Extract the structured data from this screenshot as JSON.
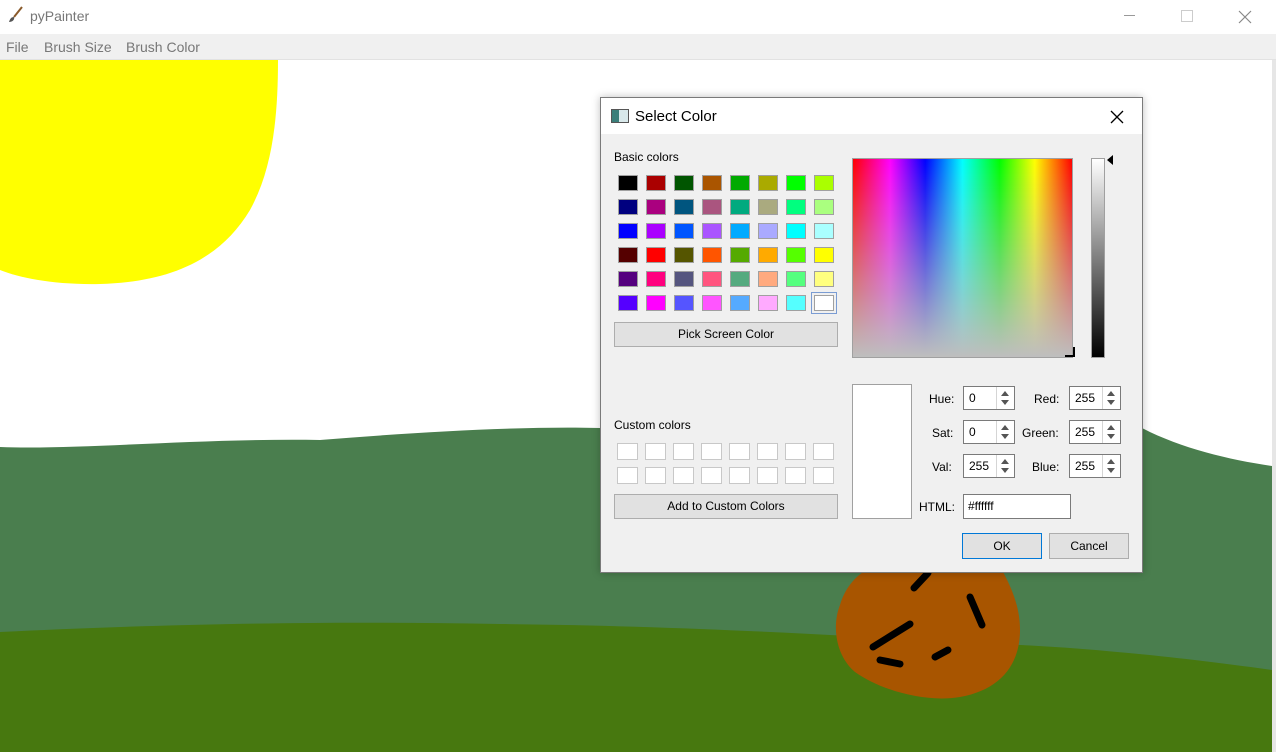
{
  "window": {
    "title": "pyPainter",
    "controls": {
      "minimize": "minimize-icon",
      "maximize": "maximize-icon",
      "close": "close-icon"
    }
  },
  "menu": [
    "File",
    "Brush Size",
    "Brush Color"
  ],
  "canvas": {
    "background": "#ffffff",
    "sun_color": "#ffff00",
    "hill_back_color": "#4a7e4e",
    "hill_front_color": "#47780f",
    "bush_color": "#a85500",
    "stroke_color": "#000000"
  },
  "dialog": {
    "title": "Select Color",
    "basic_colors_label": "Basic colors",
    "basic_colors": [
      [
        "#000000",
        "#aa0000",
        "#005500",
        "#aa5500",
        "#00aa00",
        "#aaaa00",
        "#00ff00",
        "#aaff00"
      ],
      [
        "#00007f",
        "#aa007f",
        "#00557f",
        "#aa557f",
        "#00aa7f",
        "#aaaa7f",
        "#00ff7f",
        "#aaff7f"
      ],
      [
        "#0000ff",
        "#aa00ff",
        "#0055ff",
        "#aa55ff",
        "#00aaff",
        "#aaaaff",
        "#00ffff",
        "#aaffff"
      ],
      [
        "#550000",
        "#ff0000",
        "#555500",
        "#ff5500",
        "#55aa00",
        "#ffaa00",
        "#55ff00",
        "#ffff00"
      ],
      [
        "#55007f",
        "#ff007f",
        "#55557f",
        "#ff557f",
        "#55aa7f",
        "#ffaa7f",
        "#55ff7f",
        "#ffff7f"
      ],
      [
        "#5500ff",
        "#ff00ff",
        "#5555ff",
        "#ff55ff",
        "#55aaff",
        "#ffaaff",
        "#55ffff",
        "#ffffff"
      ]
    ],
    "pick_screen_color": "Pick Screen Color",
    "custom_colors_label": "Custom colors",
    "add_custom_colors": "Add to Custom Colors",
    "fields": {
      "hue_label": "Hue:",
      "hue": "0",
      "sat_label": "Sat:",
      "sat": "0",
      "val_label": "Val:",
      "val": "255",
      "red_label": "Red:",
      "red": "255",
      "green_label": "Green:",
      "green": "255",
      "blue_label": "Blue:",
      "blue": "255",
      "html_label": "HTML:",
      "html": "#ffffff"
    },
    "ok": "OK",
    "cancel": "Cancel",
    "preview_color": "#ffffff"
  }
}
